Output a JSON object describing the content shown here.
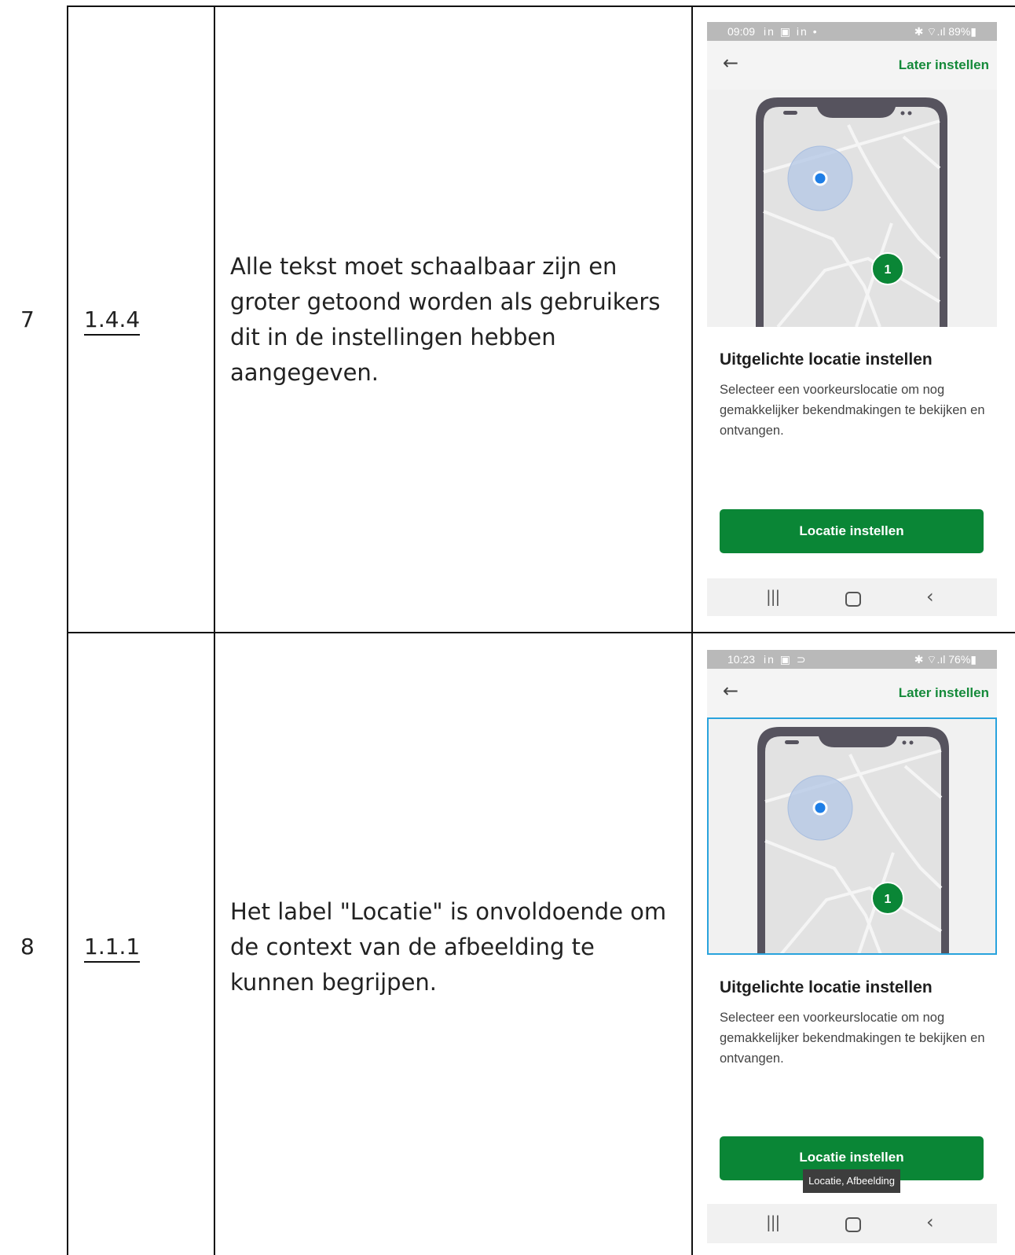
{
  "rows": [
    {
      "number": "7",
      "criterion": "1.4.4",
      "finding": "Alle tekst moet schaalbaar zijn en groter getoond worden als gebruikers dit in de instellingen hebben aangegeven.",
      "screenshot": {
        "status_time": "09:09",
        "status_icons": "in ▣ in •",
        "status_right": "✱ ⌔.ıl 89%▮",
        "back_icon": "arrow-left-icon",
        "later_link": "Later instellen",
        "pin_label": "1",
        "title": "Uitgelichte locatie instellen",
        "description": "Selecteer een voorkeurslocatie om nog gemakkelijker bekendmakingen te bekijken en ontvangen.",
        "button": "Locatie instellen",
        "nav_recent": "|||",
        "nav_back": "‹"
      }
    },
    {
      "number": "8",
      "criterion": "1.1.1",
      "finding": "Het label \"Locatie\" is onvoldoende om de context van de afbeelding te kunnen begrijpen.",
      "screenshot": {
        "status_time": "10:23",
        "status_icons": "in ▣ ⊃",
        "status_right": "✱ ⌔.ıl 76%▮",
        "back_icon": "arrow-left-icon",
        "later_link": "Later instellen",
        "pin_label": "1",
        "title": "Uitgelichte locatie instellen",
        "description": "Selecteer een voorkeurslocatie om nog gemakkelijker bekendmakingen te bekijken en ontvangen.",
        "button": "Locatie instellen",
        "tooltip": "Locatie, Afbeelding",
        "nav_recent": "|||",
        "nav_back": "‹"
      }
    }
  ],
  "colors": {
    "brand_green": "#0a8636",
    "link_green": "#158a3a",
    "focus_blue": "#29a3dd",
    "location_dot": "#1e7ee6",
    "phone_frame": "#56535e"
  }
}
